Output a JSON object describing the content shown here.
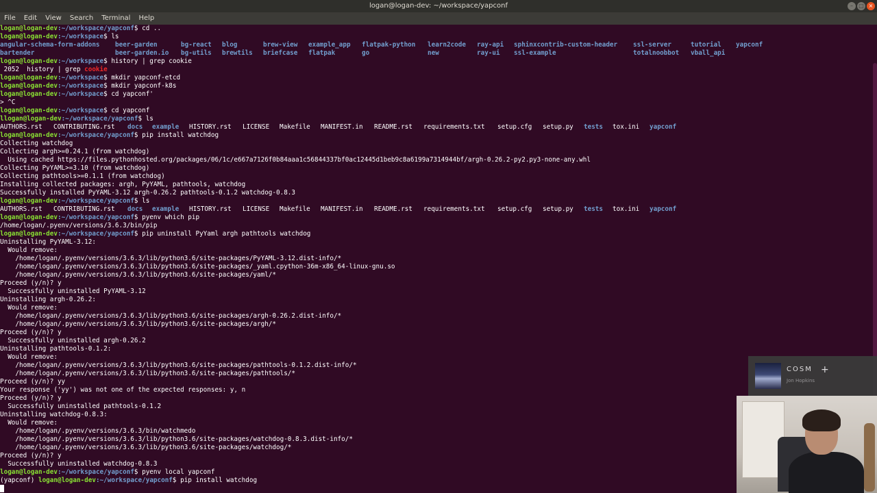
{
  "window": {
    "title": "logan@logan-dev: ~/workspace/yapconf",
    "controls": {
      "minimize": "–",
      "maximize": "□",
      "close": "×"
    }
  },
  "menu": [
    "File",
    "Edit",
    "View",
    "Search",
    "Terminal",
    "Help"
  ],
  "prompt": {
    "user": "logan@logan-dev",
    "path_workspace": "~/workspace",
    "path_yapconf": "~/workspace/yapconf"
  },
  "lines": {
    "l0": {
      "user": "logan@logan-dev",
      "path": ":~/workspace/yapconf",
      "cmd": "$ cd .."
    },
    "l1": {
      "user": "logan@logan-dev",
      "path": ":~/workspace",
      "cmd": "$ ls"
    },
    "ls_workspace": [
      [
        "angular-schema-form-addons",
        "beer-garden",
        "bg-react",
        "blog",
        "brew-view",
        "example_app",
        "flatpak-python",
        "learn2code",
        "ray-api",
        "sphinxcontrib-custom-header",
        "ssl-server",
        "tutorial",
        "yapconf"
      ],
      [
        "bartender",
        "beer-garden.io",
        "bg-utils",
        "brewtils",
        "briefcase",
        "flatpak",
        "go",
        "new",
        "ray-ui",
        "ssl-example",
        "",
        "totalnoobbot",
        "vball_api"
      ]
    ],
    "l4": {
      "user": "logan@logan-dev",
      "path": ":~/workspace",
      "cmd": "$ history | grep cookie"
    },
    "l5": {
      "pre": " 2052  history | grep ",
      "highlight": "cookie"
    },
    "l6": {
      "user": "logan@logan-dev",
      "path": ":~/workspace",
      "cmd": "$ mkdir yapconf-etcd"
    },
    "l7": {
      "user": "logan@logan-dev",
      "path": ":~/workspace",
      "cmd": "$ mkdir yapconf-k8s"
    },
    "l8": {
      "user": "logan@logan-dev",
      "path": ":~/workspace",
      "cmd": "$ cd yapconf'"
    },
    "l9": "> ^C",
    "l10": {
      "user": "logan@logan-dev",
      "path": ":~/workspace",
      "cmd": "$ cd yapconf"
    },
    "l11": {
      "user": "llogan@logan-dev",
      "path": ":~/workspace/yapconf",
      "cmd": "$ ls"
    },
    "ls_yapconf": [
      "AUTHORS.rst",
      "CONTRIBUTING.rst",
      "docs",
      "example",
      "HISTORY.rst",
      "LICENSE",
      "Makefile",
      "MANIFEST.in",
      "README.rst",
      "requirements.txt",
      "setup.cfg",
      "setup.py",
      "tests",
      "tox.ini",
      "yapconf"
    ],
    "l13": {
      "user": "logan@logan-dev",
      "path": ":~/workspace/yapconf",
      "cmd": "$ pip install watchdog"
    },
    "out1": [
      "Collecting watchdog",
      "Collecting argh>=0.24.1 (from watchdog)",
      "  Using cached https://files.pythonhosted.org/packages/06/1c/e667a7126f0b84aaa1c56844337bf0ac12445d1beb9c8a6199a7314944bf/argh-0.26.2-py2.py3-none-any.whl",
      "Collecting PyYAML>=3.10 (from watchdog)",
      "Collecting pathtools>=0.1.1 (from watchdog)",
      "Installing collected packages: argh, PyYAML, pathtools, watchdog",
      "Successfully installed PyYAML-3.12 argh-0.26.2 pathtools-0.1.2 watchdog-0.8.3"
    ],
    "l21": {
      "user": "logan@logan-dev",
      "path": ":~/workspace/yapconf",
      "cmd": "$ ls"
    },
    "l23": {
      "user": "logan@logan-dev",
      "path": ":~/workspace/yapconf",
      "cmd": "$ pyenv which pip"
    },
    "l24": "/home/logan/.pyenv/versions/3.6.3/bin/pip",
    "l25": {
      "user": "logan@logan-dev",
      "path": ":~/workspace/yapconf",
      "cmd": "$ pip uninstall PyYaml argh pathtools watchdog"
    },
    "out2": [
      "Uninstalling PyYAML-3.12:",
      "  Would remove:",
      "    /home/logan/.pyenv/versions/3.6.3/lib/python3.6/site-packages/PyYAML-3.12.dist-info/*",
      "    /home/logan/.pyenv/versions/3.6.3/lib/python3.6/site-packages/_yaml.cpython-36m-x86_64-linux-gnu.so",
      "    /home/logan/.pyenv/versions/3.6.3/lib/python3.6/site-packages/yaml/*",
      "Proceed (y/n)? y",
      "  Successfully uninstalled PyYAML-3.12",
      "Uninstalling argh-0.26.2:",
      "  Would remove:",
      "    /home/logan/.pyenv/versions/3.6.3/lib/python3.6/site-packages/argh-0.26.2.dist-info/*",
      "    /home/logan/.pyenv/versions/3.6.3/lib/python3.6/site-packages/argh/*",
      "Proceed (y/n)? y",
      "  Successfully uninstalled argh-0.26.2",
      "Uninstalling pathtools-0.1.2:",
      "  Would remove:",
      "    /home/logan/.pyenv/versions/3.6.3/lib/python3.6/site-packages/pathtools-0.1.2.dist-info/*",
      "    /home/logan/.pyenv/versions/3.6.3/lib/python3.6/site-packages/pathtools/*",
      "Proceed (y/n)? yy",
      "Your response ('yy') was not one of the expected responses: y, n",
      "Proceed (y/n)? y",
      "  Successfully uninstalled pathtools-0.1.2",
      "Uninstalling watchdog-0.8.3:",
      "  Would remove:",
      "    /home/logan/.pyenv/versions/3.6.3/bin/watchmedo",
      "    /home/logan/.pyenv/versions/3.6.3/lib/python3.6/site-packages/watchdog-0.8.3.dist-info/*",
      "    /home/logan/.pyenv/versions/3.6.3/lib/python3.6/site-packages/watchdog/*",
      "Proceed (y/n)? y",
      "  Successfully uninstalled watchdog-0.8.3"
    ],
    "l54": {
      "user": "logan@logan-dev",
      "path": ":~/workspace/yapconf",
      "cmd": "$ pyenv local yapconf"
    },
    "l55": {
      "venv": "(yapconf) ",
      "user": "logan@logan-dev",
      "path": ":~/workspace/yapconf",
      "cmd": "$ pip install watchdog"
    }
  },
  "music": {
    "title": "COSM",
    "artist": "Jon Hopkins",
    "add": "+"
  },
  "colors": {
    "background": "#300a24",
    "prompt_user": "#8ae234",
    "prompt_path": "#729fcf",
    "highlight": "#ef2929"
  }
}
